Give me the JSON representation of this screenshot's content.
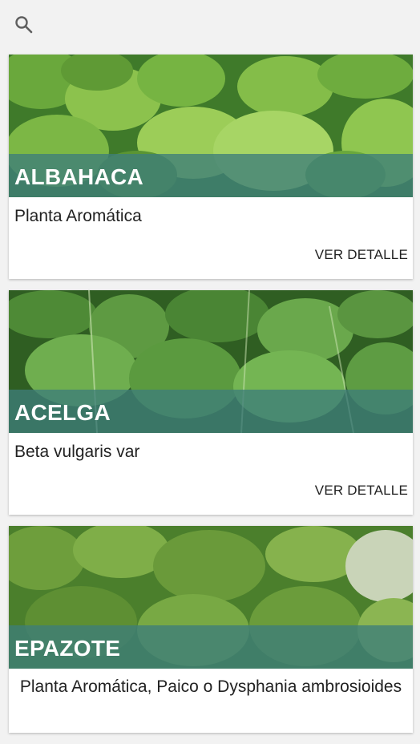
{
  "toolbar": {
    "search_icon": "search-icon"
  },
  "colors": {
    "band": "#3e7e7a",
    "background": "#f2f2f2"
  },
  "cards": [
    {
      "title": "ALBAHACA",
      "subtitle": "Planta Aromática",
      "action": "VER DETALLE"
    },
    {
      "title": "ACELGA",
      "subtitle": "Beta vulgaris var",
      "action": "VER DETALLE"
    },
    {
      "title": "EPAZOTE",
      "subtitle": "Planta Aromática, Paico o Dysphania ambrosioides"
    }
  ]
}
